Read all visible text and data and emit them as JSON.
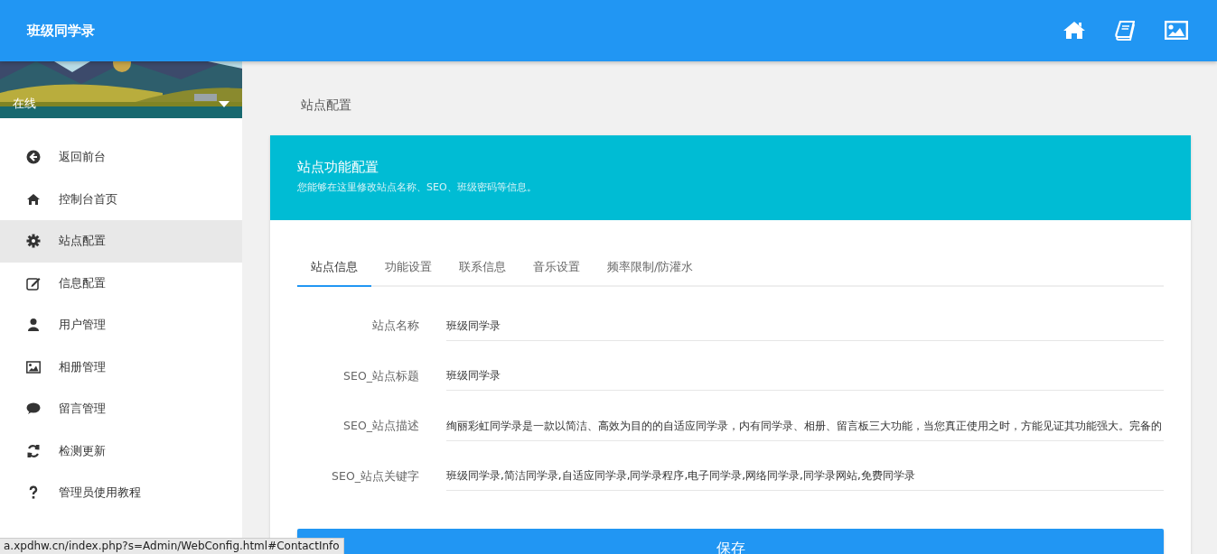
{
  "header": {
    "title": "班级同学录"
  },
  "profile": {
    "status": "在线"
  },
  "sidebar": {
    "items": [
      {
        "label": "返回前台",
        "selected": false
      },
      {
        "label": "控制台首页",
        "selected": false
      },
      {
        "label": "站点配置",
        "selected": true
      },
      {
        "label": "信息配置",
        "selected": false
      },
      {
        "label": "用户管理",
        "selected": false
      },
      {
        "label": "相册管理",
        "selected": false
      },
      {
        "label": "留言管理",
        "selected": false
      },
      {
        "label": "检测更新",
        "selected": false
      },
      {
        "label": "管理员使用教程",
        "selected": false
      }
    ]
  },
  "breadcrumb": "站点配置",
  "card": {
    "title": "站点功能配置",
    "subtitle": "您能够在这里修改站点名称、SEO、班级密码等信息。"
  },
  "tabs": [
    {
      "label": "站点信息",
      "selected": true
    },
    {
      "label": "功能设置",
      "selected": false
    },
    {
      "label": "联系信息",
      "selected": false
    },
    {
      "label": "音乐设置",
      "selected": false
    },
    {
      "label": "频率限制/防灌水",
      "selected": false
    }
  ],
  "fields": [
    {
      "label": "站点名称",
      "value": "班级同学录"
    },
    {
      "label": "SEO_站点标题",
      "value": "班级同学录"
    },
    {
      "label": "SEO_站点描述",
      "value": "绚丽彩虹同学录是一款以简洁、高效为目的的自适应同学录，内有同学录、相册、留言板三大功能，当您真正使用之时，方能见证其功能强大。完备的"
    },
    {
      "label": "SEO_站点关键字",
      "value": "班级同学录,简洁同学录,自适应同学录,同学录程序,电子同学录,网络同学录,同学录网站,免费同学录"
    }
  ],
  "save_button": "保存",
  "status_url": "a.xpdhw.cn/index.php?s=Admin/WebConfig.html#ContactInfo"
}
